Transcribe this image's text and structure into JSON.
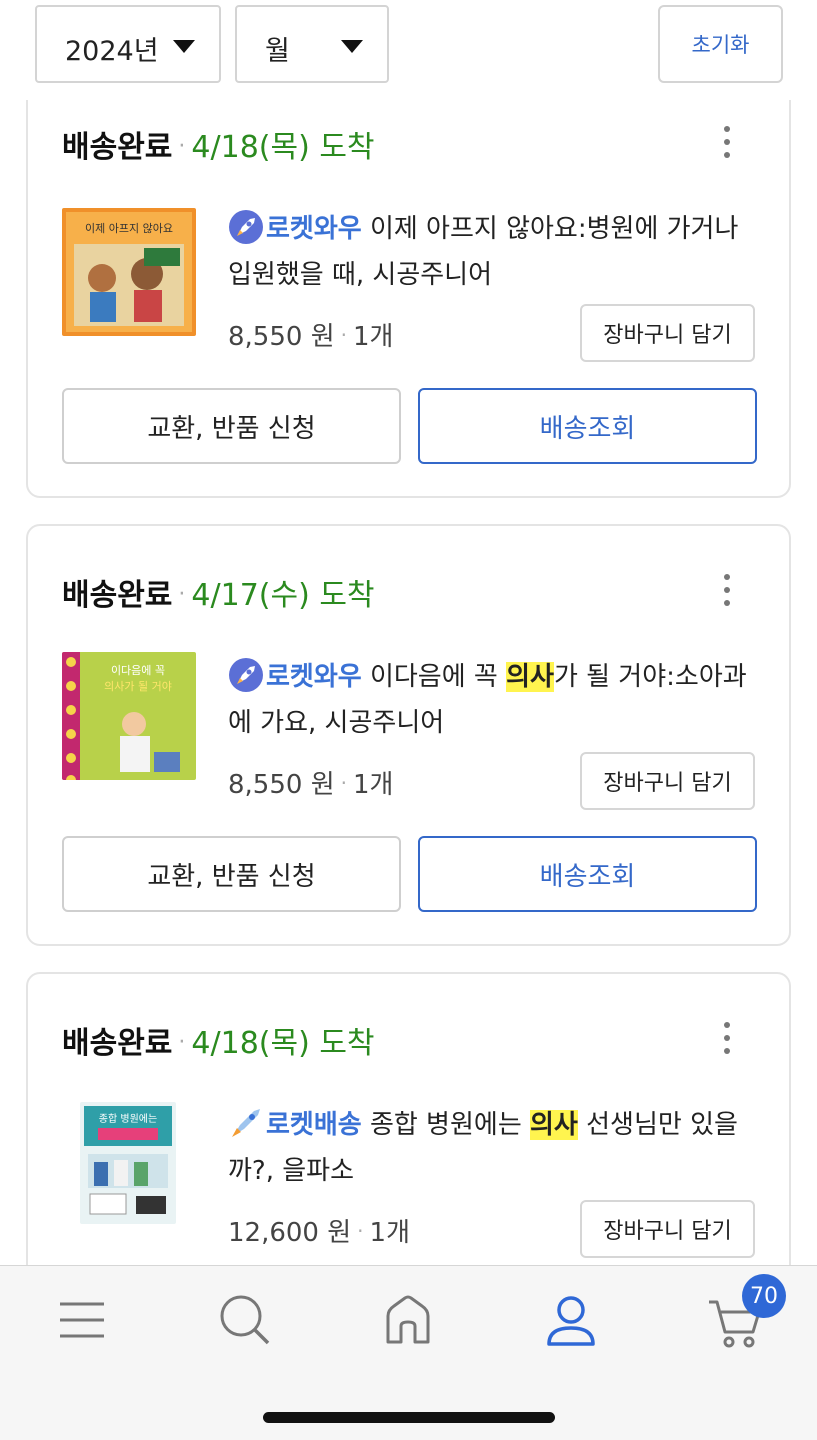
{
  "filters": {
    "year": "2024년",
    "month": "월",
    "reset_label": "초기화"
  },
  "orders": [
    {
      "status": "배송완료",
      "arrival": "4/18(목) 도착",
      "badge": "로켓와우",
      "title_before": "이제 아프지 않아요:병원에 가거나 입원했을 때, 시공주니어",
      "highlight": "",
      "title_after": "",
      "price": "8,550 원",
      "quantity": "1개",
      "cart_label": "장바구니 담기",
      "return_label": "교환, 반품 신청",
      "track_label": "배송조회",
      "cover_text": "이제 아프지 않아요"
    },
    {
      "status": "배송완료",
      "arrival": "4/17(수) 도착",
      "badge": "로켓와우",
      "title_before": "이다음에 꼭 ",
      "highlight": "의사",
      "title_after": "가 될 거야:소아과에 가요, 시공주니어",
      "price": "8,550 원",
      "quantity": "1개",
      "cart_label": "장바구니 담기",
      "return_label": "교환, 반품 신청",
      "track_label": "배송조회",
      "cover_text": "이다음에 꼭 의사가 될 거야"
    },
    {
      "status": "배송완료",
      "arrival": "4/18(목) 도착",
      "badge": "로켓배송",
      "title_before": "종합 병원에는 ",
      "highlight": "의사",
      "title_after": " 선생님만 있을까?, 을파소",
      "price": "12,600 원",
      "quantity": "1개",
      "cart_label": "장바구니 담기",
      "cover_text": "종합 병원에는 의사 선생님만 있을까?"
    }
  ],
  "tabbar": {
    "cart_count": "70"
  },
  "colors": {
    "accent": "#3468c9",
    "arrival_green": "#2b8a1f",
    "highlight": "#fff44f"
  }
}
